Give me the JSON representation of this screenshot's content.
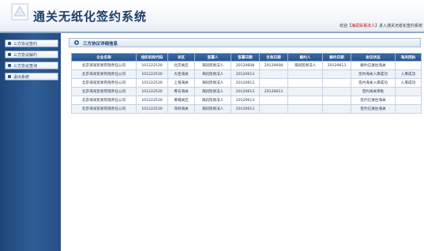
{
  "app": {
    "title": "通关无纸化签约系统",
    "welcome_prefix": "欢迎【",
    "user": "海润贸易法人",
    "welcome_suffix": "】进入通关无纸化签约系统"
  },
  "sidebar": {
    "items": [
      {
        "label": "三方协议签约"
      },
      {
        "label": "三方协议解约"
      },
      {
        "label": "三方协议查询"
      },
      {
        "label": "退出系统"
      }
    ]
  },
  "panel": {
    "title": "三方协议详细信息"
  },
  "table": {
    "columns": [
      "企业名称",
      "组织机构代码",
      "关区",
      "签署人",
      "签署日期",
      "生效日期",
      "解约人",
      "解约日期",
      "协议状态",
      "海关回执"
    ],
    "rows": [
      [
        "北京海润贸易有限责任公司",
        "101222530",
        "北京关区",
        "海润贸易法人",
        "20120608",
        "20120608",
        "海润贸易法人",
        "20120613",
        "解约已发往海关",
        ""
      ],
      [
        "北京海润贸易有限责任公司",
        "101222530",
        "大连海关",
        "海润贸易法人",
        "20120613",
        "",
        "",
        "",
        "签约海关入库成功",
        "入库成功"
      ],
      [
        "北京海润贸易有限责任公司",
        "101222530",
        "上海海关",
        "海润贸易法人",
        "20120613",
        "",
        "",
        "",
        "签约海关入库成功",
        "入库成功"
      ],
      [
        "北京海润贸易有限责任公司",
        "101222530",
        "青岛海关",
        "海润贸易法人",
        "20120613",
        "20120613",
        "",
        "",
        "签约海关审批",
        ""
      ],
      [
        "北京海润贸易有限责任公司",
        "101222530",
        "黄埔关区",
        "海润贸易法人",
        "20120613",
        "",
        "",
        "",
        "签约已发往海关",
        ""
      ],
      [
        "北京海润贸易有限责任公司",
        "101222530",
        "深圳海关",
        "海润贸易法人",
        "20120613",
        "",
        "",
        "",
        "签约已发往海关",
        ""
      ]
    ]
  },
  "colors": {
    "brand": "#1d3d6e",
    "sidebar": "#2f5d96",
    "header_row": "#25538e",
    "user": "#c00000"
  }
}
